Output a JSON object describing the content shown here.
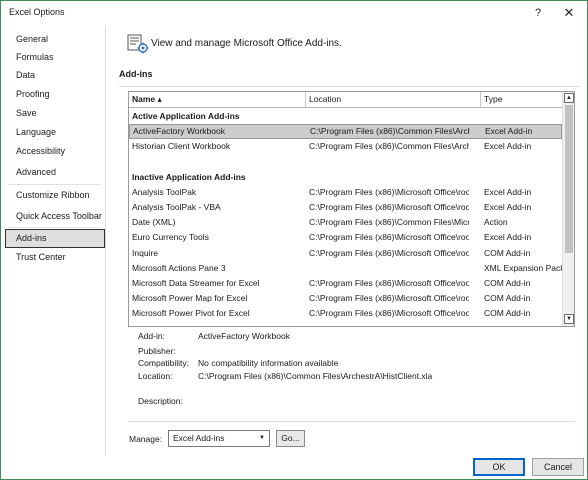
{
  "window": {
    "title": "Excel Options",
    "help_glyph": "?",
    "close_glyph": "✕"
  },
  "sidebar": {
    "items": [
      {
        "label": "General"
      },
      {
        "label": "Formulas"
      },
      {
        "label": "Data"
      },
      {
        "label": "Proofing"
      },
      {
        "label": "Save"
      },
      {
        "label": "Language"
      },
      {
        "label": "Accessibility"
      },
      {
        "label": "Advanced"
      },
      {
        "label": "Customize Ribbon"
      },
      {
        "label": "Quick Access Toolbar"
      },
      {
        "label": "Add-ins",
        "selected": true
      },
      {
        "label": "Trust Center"
      }
    ]
  },
  "header": {
    "text": "View and manage Microsoft Office Add-ins.",
    "icon": "addins-gear-icon"
  },
  "section": {
    "title": "Add-ins"
  },
  "grid": {
    "columns": {
      "name": "Name ▴",
      "location": "Location",
      "type": "Type"
    },
    "rows": [
      {
        "kind": "group",
        "name": "Active Application Add-ins",
        "location": "",
        "type": ""
      },
      {
        "kind": "item",
        "name": "ActiveFactory Workbook",
        "location": "C:\\Program Files (x86)\\Common Files\\Arch",
        "type": "Excel Add-in",
        "selected": true
      },
      {
        "kind": "item",
        "name": "Historian Client Workbook",
        "location": "C:\\Program Files (x86)\\Common Files\\Arch",
        "type": "Excel Add-in"
      },
      {
        "kind": "blank",
        "name": "",
        "location": "",
        "type": ""
      },
      {
        "kind": "group",
        "name": "Inactive Application Add-ins",
        "location": "",
        "type": ""
      },
      {
        "kind": "item",
        "name": "Analysis ToolPak",
        "location": "C:\\Program Files (x86)\\Microsoft Office\\roo",
        "type": "Excel Add-in"
      },
      {
        "kind": "item",
        "name": "Analysis ToolPak - VBA",
        "location": "C:\\Program Files (x86)\\Microsoft Office\\roo",
        "type": "Excel Add-in"
      },
      {
        "kind": "item",
        "name": "Date (XML)",
        "location": "C:\\Program Files (x86)\\Common Files\\Micr",
        "type": "Action"
      },
      {
        "kind": "item",
        "name": "Euro Currency Tools",
        "location": "C:\\Program Files (x86)\\Microsoft Office\\roo",
        "type": "Excel Add-in"
      },
      {
        "kind": "item",
        "name": "Inquire",
        "location": "C:\\Program Files (x86)\\Microsoft Office\\roo",
        "type": "COM Add-in"
      },
      {
        "kind": "item",
        "name": "Microsoft Actions Pane 3",
        "location": "",
        "type": "XML Expansion Pack"
      },
      {
        "kind": "item",
        "name": "Microsoft Data Streamer for Excel",
        "location": "C:\\Program Files (x86)\\Microsoft Office\\roo",
        "type": "COM Add-in"
      },
      {
        "kind": "item",
        "name": "Microsoft Power Map for Excel",
        "location": "C:\\Program Files (x86)\\Microsoft Office\\roo",
        "type": "COM Add-in"
      },
      {
        "kind": "item",
        "name": "Microsoft Power Pivot for Excel",
        "location": "C:\\Program Files (x86)\\Microsoft Office\\roo",
        "type": "COM Add-in"
      }
    ],
    "scroll_up_glyph": "▲",
    "scroll_down_glyph": "▼"
  },
  "details": {
    "addin_label": "Add-in:",
    "addin_value": "ActiveFactory Workbook",
    "publisher_label": "Publisher:",
    "publisher_value": "",
    "compat_label": "Compatibility:",
    "compat_value": "No compatibility information available",
    "location_label": "Location:",
    "location_value": "C:\\Program Files (x86)\\Common Files\\ArchestrA\\HistClient.xla",
    "description_label": "Description:",
    "description_value": ""
  },
  "manage": {
    "label": "Manage:",
    "selected": "Excel Add-ins",
    "dropdown_glyph": "▼",
    "go_label": "Go..."
  },
  "footer": {
    "ok_label": "OK",
    "cancel_label": "Cancel"
  },
  "colors": {
    "window_border": "#3c8c5a",
    "selection_gray": "#cdcdcd",
    "ok_focus": "#0066cc"
  }
}
